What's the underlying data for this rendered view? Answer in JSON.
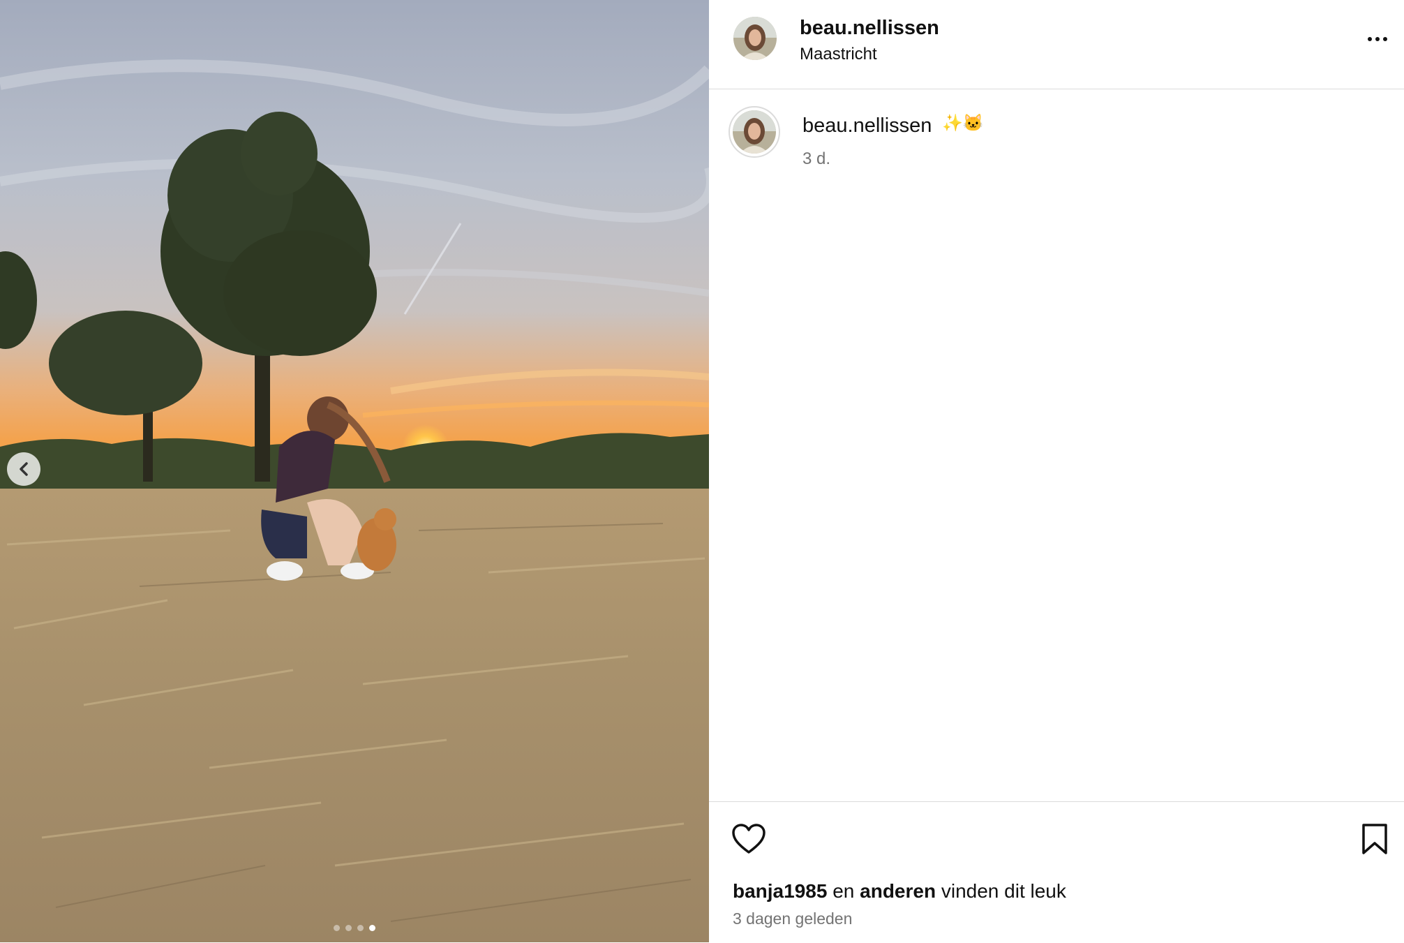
{
  "post": {
    "username": "beau.nellissen",
    "location": "Maastricht",
    "caption_user": "beau.nellissen",
    "caption_emoji": "✨🐱",
    "caption_time": "3 d.",
    "likes": {
      "user": "banja1985",
      "connector": "en",
      "others": "anderen",
      "suffix": "vinden dit leuk"
    },
    "age": "3 dagen geleden"
  },
  "carousel": {
    "slide_count": 4,
    "active_index": 3
  },
  "icons": {
    "prev": "chevron-left-icon",
    "more": "more-options-icon",
    "like": "heart-icon",
    "save": "bookmark-icon"
  },
  "colors": {
    "text": "#111111",
    "muted": "#737373",
    "divider": "#dbdbdb",
    "background": "#ffffff"
  }
}
